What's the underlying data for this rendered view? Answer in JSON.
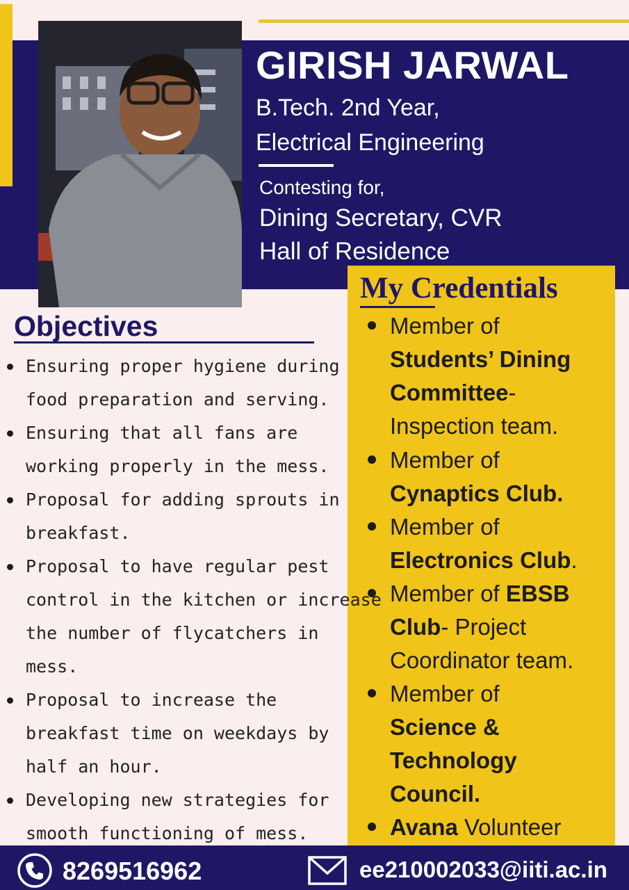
{
  "header": {
    "name": "GIRISH JARWAL",
    "year": "B.Tech. 2nd Year,",
    "department": "Electrical Engineering",
    "contesting_label": "Contesting for,",
    "position_line1": "Dining Secretary, CVR",
    "position_line2": "Hall of Residence"
  },
  "objectives": {
    "title": "Objectives",
    "lines": [
      "Ensuring proper hygiene during",
      "food preparation and serving.",
      "Ensuring that all fans are",
      "working properly in the mess.",
      "Proposal for adding sprouts in",
      "breakfast.",
      "Proposal to have regular pest",
      "control in the kitchen or increase",
      "the number of flycatchers in",
      "mess.",
      "Proposal to increase the",
      "breakfast time on weekdays by",
      "half an hour.",
      "Developing new strategies for",
      "smooth functioning of mess."
    ]
  },
  "credentials": {
    "title": "My Credentials",
    "lines": [
      {
        "normal": "Member of",
        "bold": ""
      },
      {
        "normal": "",
        "bold": "Students’ Dining"
      },
      {
        "normal": "-",
        "bold": "Committee"
      },
      {
        "normal": "Inspection team.",
        "bold": ""
      },
      {
        "normal": "Member of",
        "bold": ""
      },
      {
        "normal": "",
        "bold": "Cynaptics Club."
      },
      {
        "normal": "Member of",
        "bold": ""
      },
      {
        "normal": ".",
        "bold": "Electronics Club"
      },
      {
        "normal": "Member of ",
        "bold": "EBSB"
      },
      {
        "normal": "- Project",
        "bold": "Club"
      },
      {
        "normal": "Coordinator team.",
        "bold": ""
      },
      {
        "normal": "Member of",
        "bold": ""
      },
      {
        "normal": "",
        "bold": "Science &"
      },
      {
        "normal": "",
        "bold": "Technology"
      },
      {
        "normal": "",
        "bold": "Council."
      },
      {
        "normal": " Volunteer",
        "bold": "Avana"
      }
    ]
  },
  "footer": {
    "phone": "8269516962",
    "email": "ee210002033@iiti.ac.in",
    "phone_icon": "phone-icon",
    "mail_icon": "mail-icon"
  },
  "colors": {
    "navy": "#1f1766",
    "yellow": "#f0c419",
    "background": "#fbeeee"
  }
}
